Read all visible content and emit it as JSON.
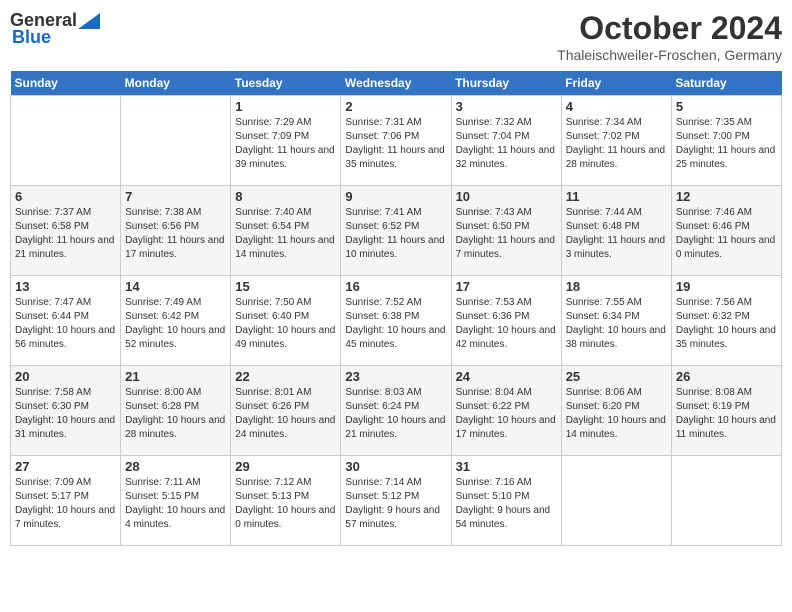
{
  "header": {
    "logo_general": "General",
    "logo_blue": "Blue",
    "month_title": "October 2024",
    "location": "Thaleischweiler-Froschen, Germany"
  },
  "weekdays": [
    "Sunday",
    "Monday",
    "Tuesday",
    "Wednesday",
    "Thursday",
    "Friday",
    "Saturday"
  ],
  "weeks": [
    [
      {
        "day": "",
        "info": ""
      },
      {
        "day": "",
        "info": ""
      },
      {
        "day": "1",
        "info": "Sunrise: 7:29 AM\nSunset: 7:09 PM\nDaylight: 11 hours and 39 minutes."
      },
      {
        "day": "2",
        "info": "Sunrise: 7:31 AM\nSunset: 7:06 PM\nDaylight: 11 hours and 35 minutes."
      },
      {
        "day": "3",
        "info": "Sunrise: 7:32 AM\nSunset: 7:04 PM\nDaylight: 11 hours and 32 minutes."
      },
      {
        "day": "4",
        "info": "Sunrise: 7:34 AM\nSunset: 7:02 PM\nDaylight: 11 hours and 28 minutes."
      },
      {
        "day": "5",
        "info": "Sunrise: 7:35 AM\nSunset: 7:00 PM\nDaylight: 11 hours and 25 minutes."
      }
    ],
    [
      {
        "day": "6",
        "info": "Sunrise: 7:37 AM\nSunset: 6:58 PM\nDaylight: 11 hours and 21 minutes."
      },
      {
        "day": "7",
        "info": "Sunrise: 7:38 AM\nSunset: 6:56 PM\nDaylight: 11 hours and 17 minutes."
      },
      {
        "day": "8",
        "info": "Sunrise: 7:40 AM\nSunset: 6:54 PM\nDaylight: 11 hours and 14 minutes."
      },
      {
        "day": "9",
        "info": "Sunrise: 7:41 AM\nSunset: 6:52 PM\nDaylight: 11 hours and 10 minutes."
      },
      {
        "day": "10",
        "info": "Sunrise: 7:43 AM\nSunset: 6:50 PM\nDaylight: 11 hours and 7 minutes."
      },
      {
        "day": "11",
        "info": "Sunrise: 7:44 AM\nSunset: 6:48 PM\nDaylight: 11 hours and 3 minutes."
      },
      {
        "day": "12",
        "info": "Sunrise: 7:46 AM\nSunset: 6:46 PM\nDaylight: 11 hours and 0 minutes."
      }
    ],
    [
      {
        "day": "13",
        "info": "Sunrise: 7:47 AM\nSunset: 6:44 PM\nDaylight: 10 hours and 56 minutes."
      },
      {
        "day": "14",
        "info": "Sunrise: 7:49 AM\nSunset: 6:42 PM\nDaylight: 10 hours and 52 minutes."
      },
      {
        "day": "15",
        "info": "Sunrise: 7:50 AM\nSunset: 6:40 PM\nDaylight: 10 hours and 49 minutes."
      },
      {
        "day": "16",
        "info": "Sunrise: 7:52 AM\nSunset: 6:38 PM\nDaylight: 10 hours and 45 minutes."
      },
      {
        "day": "17",
        "info": "Sunrise: 7:53 AM\nSunset: 6:36 PM\nDaylight: 10 hours and 42 minutes."
      },
      {
        "day": "18",
        "info": "Sunrise: 7:55 AM\nSunset: 6:34 PM\nDaylight: 10 hours and 38 minutes."
      },
      {
        "day": "19",
        "info": "Sunrise: 7:56 AM\nSunset: 6:32 PM\nDaylight: 10 hours and 35 minutes."
      }
    ],
    [
      {
        "day": "20",
        "info": "Sunrise: 7:58 AM\nSunset: 6:30 PM\nDaylight: 10 hours and 31 minutes."
      },
      {
        "day": "21",
        "info": "Sunrise: 8:00 AM\nSunset: 6:28 PM\nDaylight: 10 hours and 28 minutes."
      },
      {
        "day": "22",
        "info": "Sunrise: 8:01 AM\nSunset: 6:26 PM\nDaylight: 10 hours and 24 minutes."
      },
      {
        "day": "23",
        "info": "Sunrise: 8:03 AM\nSunset: 6:24 PM\nDaylight: 10 hours and 21 minutes."
      },
      {
        "day": "24",
        "info": "Sunrise: 8:04 AM\nSunset: 6:22 PM\nDaylight: 10 hours and 17 minutes."
      },
      {
        "day": "25",
        "info": "Sunrise: 8:06 AM\nSunset: 6:20 PM\nDaylight: 10 hours and 14 minutes."
      },
      {
        "day": "26",
        "info": "Sunrise: 8:08 AM\nSunset: 6:19 PM\nDaylight: 10 hours and 11 minutes."
      }
    ],
    [
      {
        "day": "27",
        "info": "Sunrise: 7:09 AM\nSunset: 5:17 PM\nDaylight: 10 hours and 7 minutes."
      },
      {
        "day": "28",
        "info": "Sunrise: 7:11 AM\nSunset: 5:15 PM\nDaylight: 10 hours and 4 minutes."
      },
      {
        "day": "29",
        "info": "Sunrise: 7:12 AM\nSunset: 5:13 PM\nDaylight: 10 hours and 0 minutes."
      },
      {
        "day": "30",
        "info": "Sunrise: 7:14 AM\nSunset: 5:12 PM\nDaylight: 9 hours and 57 minutes."
      },
      {
        "day": "31",
        "info": "Sunrise: 7:16 AM\nSunset: 5:10 PM\nDaylight: 9 hours and 54 minutes."
      },
      {
        "day": "",
        "info": ""
      },
      {
        "day": "",
        "info": ""
      }
    ]
  ]
}
